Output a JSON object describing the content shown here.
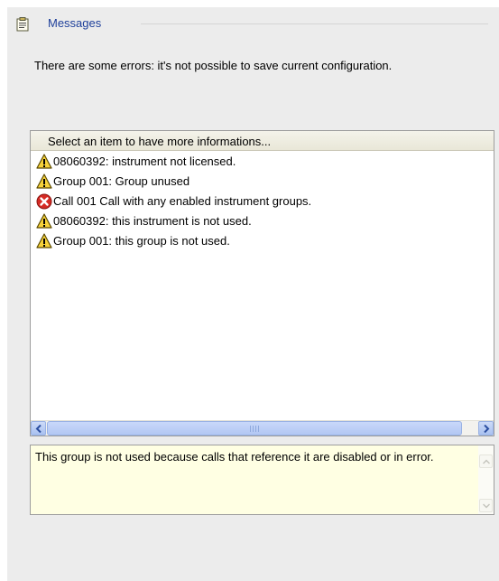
{
  "header": {
    "title": "Messages",
    "icon": "notepad-icon"
  },
  "summary": {
    "text": "There are some errors: it's not possible to save current configuration."
  },
  "message_list": {
    "header": "Select an item to have more informations...",
    "items": [
      {
        "icon": "warning-icon",
        "text": "08060392: instrument not licensed."
      },
      {
        "icon": "warning-icon",
        "text": "Group 001: Group unused"
      },
      {
        "icon": "error-icon",
        "text": "Call 001 Call with any enabled instrument groups."
      },
      {
        "icon": "warning-icon",
        "text": "08060392: this instrument is not used."
      },
      {
        "icon": "warning-icon",
        "text": "Group 001: this group is not used."
      }
    ]
  },
  "detail": {
    "text": "This group is not used because calls that reference it are disabled or in error."
  },
  "colors": {
    "title": "#1e3f9a",
    "panel_bg": "#ececec",
    "detail_bg": "#ffffe3",
    "warning_yellow": "#f7d23a",
    "error_red": "#d52a24"
  }
}
